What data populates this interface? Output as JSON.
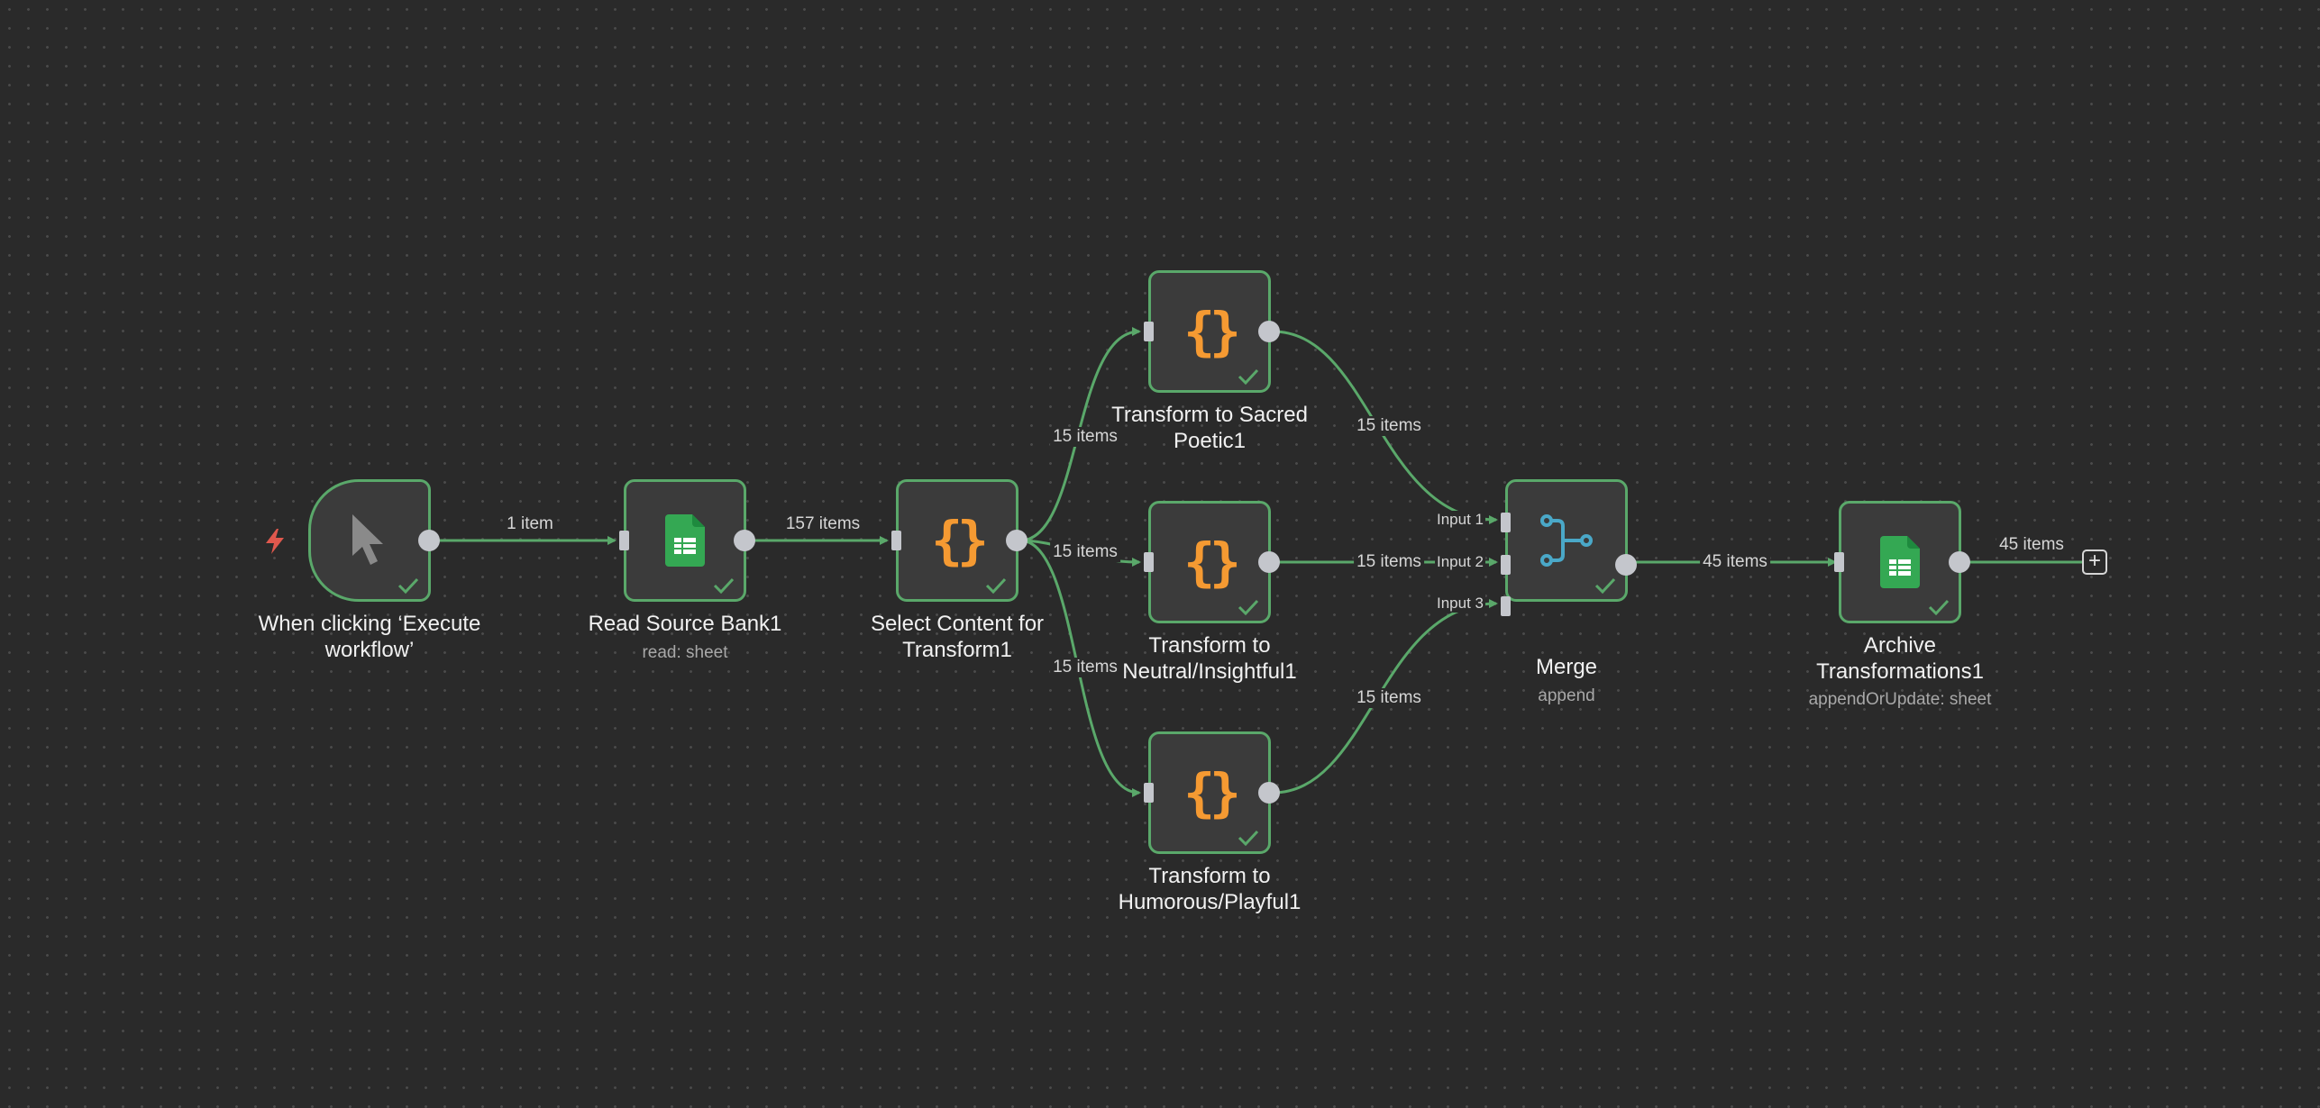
{
  "nodes": {
    "trigger": {
      "title": "When clicking ‘Execute workflow’",
      "subtitle": ""
    },
    "read_source": {
      "title": "Read Source Bank1",
      "subtitle": "read: sheet"
    },
    "select_content": {
      "title": "Select Content for Transform1",
      "subtitle": ""
    },
    "transform_sacred": {
      "title": "Transform to Sacred Poetic1",
      "subtitle": ""
    },
    "transform_neutral": {
      "title": "Transform to Neutral/Insightful1",
      "subtitle": ""
    },
    "transform_humorous": {
      "title": "Transform to Humorous/Playful1",
      "subtitle": ""
    },
    "merge": {
      "title": "Merge",
      "subtitle": "append",
      "inputs": [
        "Input 1",
        "Input 2",
        "Input 3"
      ]
    },
    "archive": {
      "title": "Archive Transformations1",
      "subtitle": "appendOrUpdate: sheet"
    }
  },
  "edges": {
    "trigger_to_read": "1 item",
    "read_to_select": "157 items",
    "select_to_sacred": "15 items",
    "select_to_neutral": "15 items",
    "select_to_humorous": "15 items",
    "sacred_to_merge": "15 items",
    "neutral_to_merge": "15 items",
    "humorous_to_merge": "15 items",
    "merge_to_archive": "45 items",
    "archive_out": "45 items"
  },
  "icons": {
    "trigger": "mouse-pointer-icon",
    "sheets": "google-sheets-icon",
    "code": "code-braces-icon",
    "merge": "merge-icon",
    "success": "checkmark-icon",
    "bolt": "lightning-bolt-icon",
    "add": "plus-icon"
  },
  "colors": {
    "canvas": "#2a2a2a",
    "node_fill": "#3b3b3b",
    "success_green": "#5aa86a",
    "code_orange": "#f59a32",
    "sheets_green": "#34a853",
    "merge_blue": "#4aa8c8",
    "bolt_red": "#e0584d"
  },
  "add_button": {
    "label": "+"
  }
}
